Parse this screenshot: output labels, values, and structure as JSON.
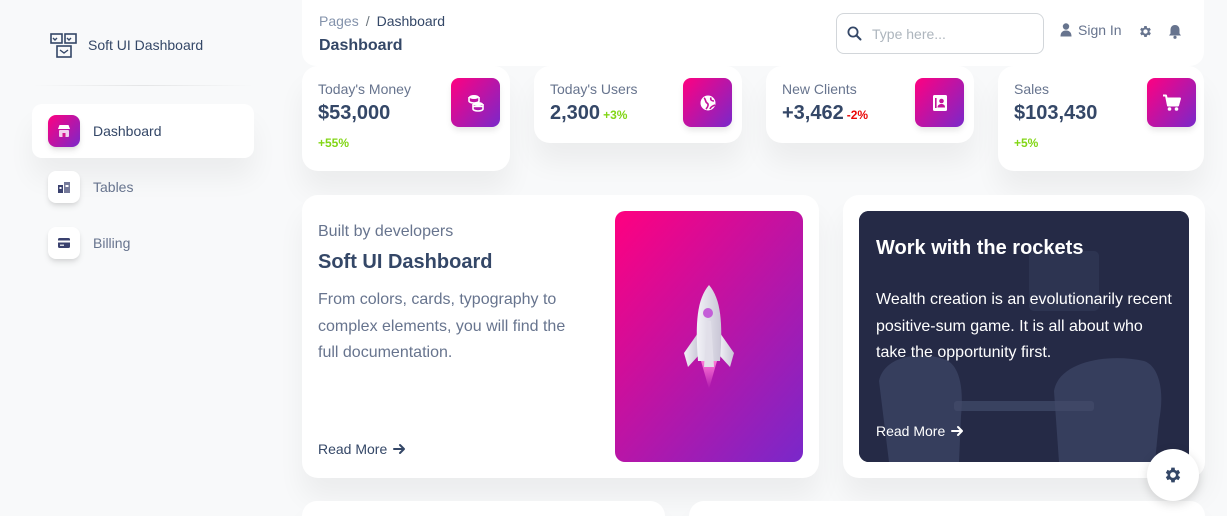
{
  "brand": {
    "name": "Soft UI Dashboard"
  },
  "sidebar": {
    "items": [
      {
        "label": "Dashboard",
        "icon": "shop-icon",
        "active": true
      },
      {
        "label": "Tables",
        "icon": "office-icon",
        "active": false
      },
      {
        "label": "Billing",
        "icon": "credit-card-icon",
        "active": false
      }
    ]
  },
  "navbar": {
    "breadcrumb": {
      "root": "Pages",
      "separator": "/",
      "current": "Dashboard"
    },
    "title": "Dashboard",
    "search_placeholder": "Type here...",
    "signin_label": "Sign In"
  },
  "stats": [
    {
      "label": "Today's Money",
      "value": "$53,000",
      "change": "+55%",
      "change_inline": false,
      "trend": "positive",
      "icon": "database-icon"
    },
    {
      "label": "Today's Users",
      "value": "2,300",
      "change": "+3%",
      "change_inline": true,
      "trend": "positive",
      "icon": "globe-icon"
    },
    {
      "label": "New Clients",
      "value": "+3,462",
      "change": "-2%",
      "change_inline": true,
      "trend": "negative",
      "icon": "document-icon"
    },
    {
      "label": "Sales",
      "value": "$103,430",
      "change": "+5%",
      "change_inline": false,
      "trend": "positive",
      "icon": "cart-icon"
    }
  ],
  "feature": {
    "subtitle": "Built by developers",
    "title": "Soft UI Dashboard",
    "description": "From colors, cards, typography to complex elements, you will find the full documentation.",
    "read_more": "Read More"
  },
  "rockets": {
    "title": "Work with the rockets",
    "description": "Wealth creation is an evolutionarily recent positive-sum game. It is all about who take the opportunity first.",
    "read_more": "Read More"
  },
  "colors": {
    "accent_start": "#7928ca",
    "accent_end": "#ff0080",
    "text_primary": "#344767",
    "text_secondary": "#67748e",
    "positive": "#82d616",
    "negative": "#ea0606"
  }
}
